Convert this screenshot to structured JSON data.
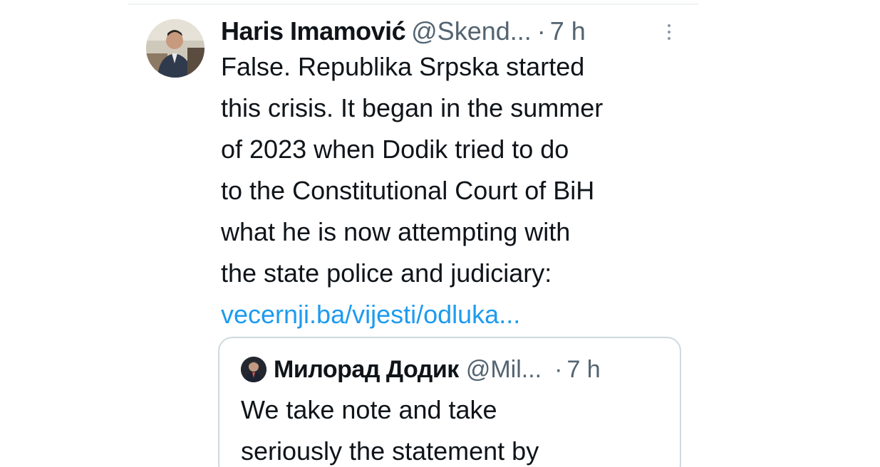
{
  "tweet": {
    "author": {
      "name": "Haris Imamović",
      "handle": "@Skend...",
      "separator": "·",
      "time": "7 h",
      "avatar_icon": "person-photo-avatar"
    },
    "body_lines": [
      "False. Republika Srpska started",
      "this crisis. It began in the summer",
      "of 2023 when Dodik tried to do",
      "to the Constitutional Court of BiH",
      "what he is now attempting with",
      "the state police and judiciary:"
    ],
    "link": "vecernji.ba/vijesti/odluka...",
    "more_icon": "more-options-icon"
  },
  "quoted_tweet": {
    "author": {
      "name": "Милорад Додик",
      "handle": "@Mil...",
      "separator": "·",
      "time": "7 h",
      "avatar_icon": "person-photo-avatar"
    },
    "body_lines": [
      "We take note and take",
      "seriously the statement by"
    ]
  },
  "colors": {
    "text_primary": "#0f1419",
    "text_secondary": "#536471",
    "link": "#1d9bf0",
    "border": "#cfd9de"
  }
}
